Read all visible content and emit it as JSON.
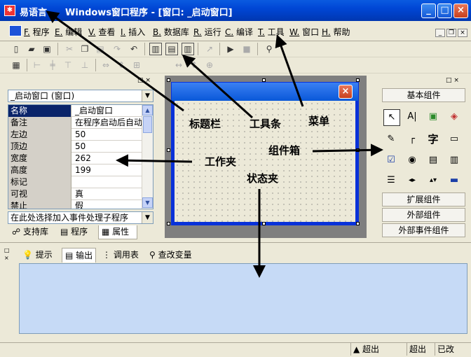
{
  "title": {
    "app_name": "易语言",
    "doc": "Windows窗口程序 - [窗口: _启动窗口]"
  },
  "window_buttons": [
    "_",
    "□",
    "×"
  ],
  "menu": [
    {
      "key": "F.",
      "label": "程序"
    },
    {
      "key": "E.",
      "label": "编辑"
    },
    {
      "key": "V.",
      "label": "查看"
    },
    {
      "key": "I.",
      "label": "插入"
    },
    {
      "key": "B.",
      "label": "数据库"
    },
    {
      "key": "R.",
      "label": "运行"
    },
    {
      "key": "C.",
      "label": "编译"
    },
    {
      "key": "T.",
      "label": "工具"
    },
    {
      "key": "W.",
      "label": "窗口"
    },
    {
      "key": "H.",
      "label": "帮助"
    }
  ],
  "left_panel": {
    "object_combo": "_启动窗口 (窗口)",
    "properties": [
      {
        "name": "名称",
        "value": "_启动窗口"
      },
      {
        "name": "备注",
        "value": "在程序启动后自动"
      },
      {
        "name": "左边",
        "value": "50"
      },
      {
        "name": "顶边",
        "value": "50"
      },
      {
        "name": "宽度",
        "value": "262"
      },
      {
        "name": "高度",
        "value": "199"
      },
      {
        "name": "标记",
        "value": ""
      },
      {
        "name": "可视",
        "value": "真"
      },
      {
        "name": "禁止",
        "value": "假"
      }
    ],
    "event_combo": "在此处选择加入事件处理子程序",
    "tabs": [
      "支持库",
      "程序",
      "属性"
    ]
  },
  "right_panel": {
    "basic": "基本组件",
    "extended": "扩展组件",
    "external": "外部组件",
    "external_events": "外部事件组件",
    "icons": [
      "cursor-icon",
      "label-icon",
      "picture-icon",
      "shape-icon",
      "edit-icon",
      "groupbox-icon",
      "text-icon",
      "frame-icon",
      "checkbox-icon",
      "radio-icon",
      "listbox-icon",
      "combobox-icon",
      "list-icon",
      "hscroll-icon",
      "vscroll-icon",
      "progress-icon"
    ],
    "icon_glyphs": [
      "↖",
      "A|",
      "▣",
      "◈",
      "✎",
      "┌",
      "字",
      "▭",
      "☑",
      "◉",
      "▤",
      "▥",
      "☰",
      "◂▸",
      "▴▾",
      "▬"
    ]
  },
  "bottom": {
    "tabs": [
      "提示",
      "输出",
      "调用表",
      "查改变量"
    ]
  },
  "status": {
    "c1": "超出",
    "c2": "超出",
    "c3": "已改"
  },
  "annotations": {
    "title_bar": "标题栏",
    "toolbar": "工具条",
    "menu": "菜单",
    "component_box": "组件箱",
    "work_folder": "工作夹",
    "status_folder": "状态夹"
  },
  "colors": {
    "titlebar": "#0046D5",
    "output_bg": "#C6DAF6",
    "selection": "#0A246A"
  }
}
